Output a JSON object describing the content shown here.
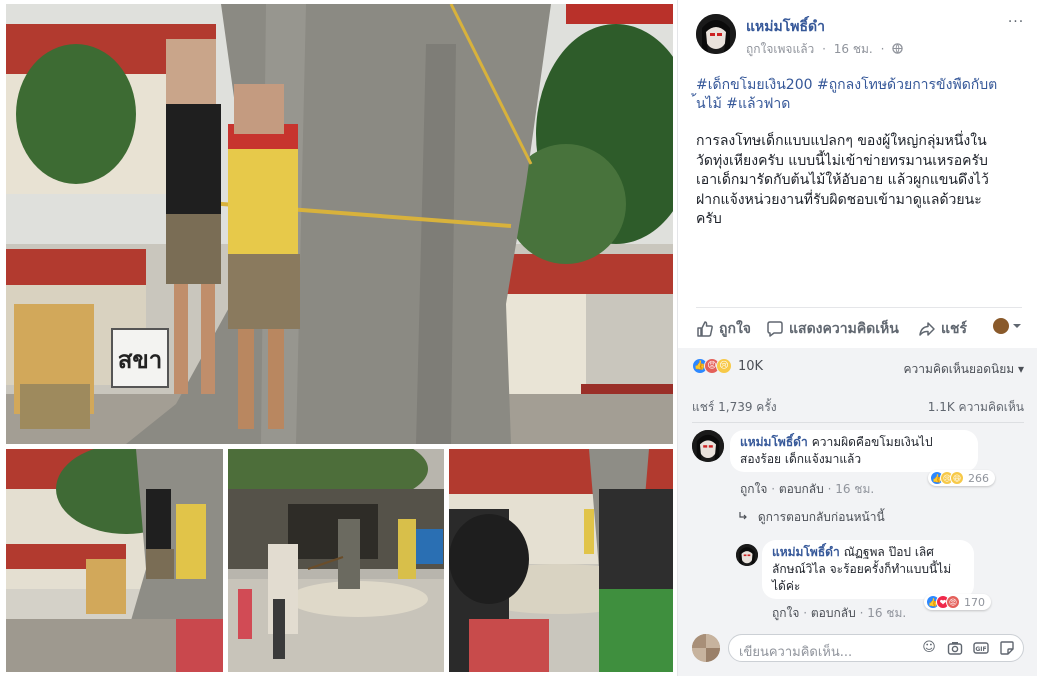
{
  "post": {
    "author": "แหม่มโพธิ์ดำ",
    "meta_liked": "ถูกใจเพจแล้ว",
    "meta_time": "16 ชม.",
    "meta_privacy_icon": "globe-icon",
    "more_label": "···",
    "hashtags": [
      "#เด็กขโมยเงิน200",
      "#ถูกลงโทษด้วยการขังพืดกับต",
      "้นไม้",
      "#แล้วฟาด"
    ],
    "hashtag_lines": [
      "#เด็กขโมยเงิน200 #ถูกลงโทษด้วยการขังพืดกับต",
      "้นไม้ #แล้วฟาด"
    ],
    "text_lines": [
      "การลงโทษเด็กแบบแปลกๆ ของผู้ใหญ่กลุ่มหนึ่งใน",
      "วัดทุ่งเหียงครับ แบบนี้ไม่เข้าข่ายทรมานเหรอครับ",
      "เอาเด็กมารัดกับต้นไม้ให้อับอาย แล้วผูกแขนดึงไว้",
      "ฝากแจ้งหน่วยงานที่รับผิดชอบเข้ามาดูแลด้วยนะ",
      "ครับ"
    ]
  },
  "actions": {
    "like": "ถูกใจ",
    "comment": "แสดงความคิดเห็น",
    "share": "แชร์"
  },
  "reactions": {
    "count": "10K",
    "icons": [
      "like",
      "angry",
      "sad"
    ],
    "sort_label": "ความคิดเห็นยอดนิยม ▾"
  },
  "stats": {
    "shares": "แชร์ 1,739 ครั้ง",
    "comments": "1.1K ความคิดเห็น"
  },
  "comments": [
    {
      "author": "แหม่มโพธิ์ดำ",
      "lines": [
        "ความผิดคือขโมยเงินไป",
        "สองร้อย เด็กแจ้งมาแล้ว"
      ],
      "like": "ถูกใจ",
      "reply": "ตอบกลับ",
      "time": "16 ชม.",
      "reaction_count": "266",
      "reaction_icons": [
        "like",
        "sad",
        "haha"
      ]
    },
    {
      "author": "แหม่มโพธิ์ดำ",
      "lines": [
        "ณัฏฐพล ป๊อป เลิศ",
        "ลักษณ์วิไล จะร้อยครั้งก็ทำแบบนี้ไม่",
        "ได้ค่ะ"
      ],
      "like": "ถูกใจ",
      "reply": "ตอบกลับ",
      "time": "16 ชม.",
      "reaction_count": "170",
      "reaction_icons": [
        "like",
        "love",
        "angry"
      ]
    }
  ],
  "previous_replies": "ดูการตอบกลับก่อนหน้านี้",
  "composer": {
    "placeholder": "เขียนความคิดเห็น...",
    "icons": [
      "emoji-icon",
      "camera-icon",
      "gif-icon",
      "sticker-icon"
    ]
  },
  "photos": {
    "sign_text": "สขา"
  },
  "colors": {
    "link": "#365899",
    "text": "#1d2129",
    "secondary": "#90949c",
    "comments_bg": "#f2f3f5"
  }
}
